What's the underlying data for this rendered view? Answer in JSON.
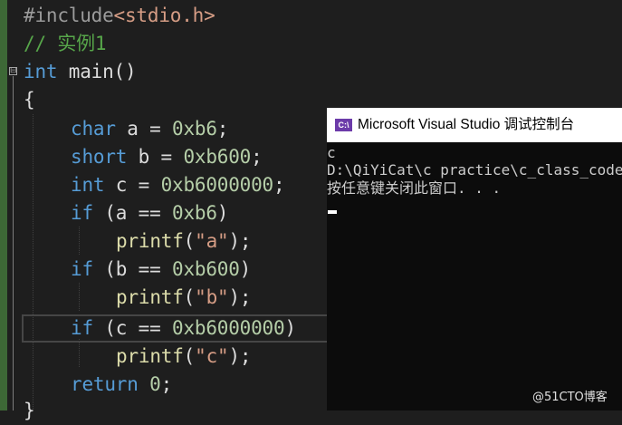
{
  "editor": {
    "line1": {
      "directive": "#include",
      "header": "<stdio.h>"
    },
    "line2": {
      "comment": "// 实例1"
    },
    "line3": {
      "kw": "int",
      "rest": " main()"
    },
    "line4": {
      "brace": "{"
    },
    "line5": {
      "kw": "char",
      "mid": " a = ",
      "num": "0xb6",
      "end": ";"
    },
    "line6": {
      "kw": "short",
      "mid": " b = ",
      "num": "0xb600",
      "end": ";"
    },
    "line7": {
      "kw": "int",
      "mid": " c = ",
      "num": "0xb6000000",
      "end": ";"
    },
    "line8": {
      "kw": "if",
      "mid": " (a == ",
      "num": "0xb6",
      "end": ")"
    },
    "line9": {
      "fn": "printf",
      "open": "(",
      "str": "\"a\"",
      "end": ");"
    },
    "line10": {
      "kw": "if",
      "mid": " (b == ",
      "num": "0xb600",
      "end": ")"
    },
    "line11": {
      "fn": "printf",
      "open": "(",
      "str": "\"b\"",
      "end": ");"
    },
    "line12": {
      "kw": "if",
      "mid": " (c == ",
      "num": "0xb6000000",
      "end": ")"
    },
    "line13": {
      "fn": "printf",
      "open": "(",
      "str": "\"c\"",
      "end": ");"
    },
    "line14": {
      "kw": "return",
      "mid": " ",
      "num": "0",
      "end": ";"
    },
    "line15": {
      "brace": "}"
    },
    "collapse_symbol": "⊟"
  },
  "console": {
    "icon_text": "C:\\",
    "title": "Microsoft Visual Studio 调试控制台",
    "lines": [
      "c",
      "D:\\QiYiCat\\c practice\\c_class_code",
      "按任意键关闭此窗口. . ."
    ]
  },
  "watermark": "@51CTO博客",
  "colors": {
    "keyword": "#569cd6",
    "string": "#d69d85",
    "number": "#b5cea8",
    "comment": "#57a64a",
    "function": "#dcdcaa",
    "console_bg": "#0c0c0c",
    "editor_bg": "#1e1e1e"
  }
}
